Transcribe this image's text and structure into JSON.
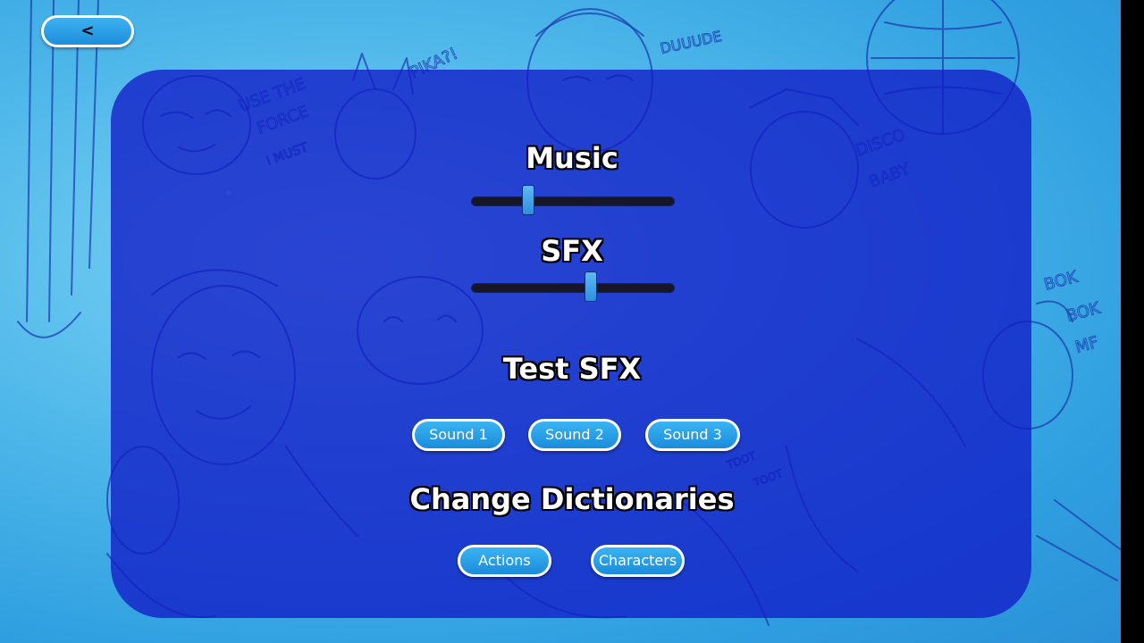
{
  "back_button": {
    "icon": "chevron-left-icon",
    "glyph": "<"
  },
  "settings": {
    "music": {
      "label": "Music",
      "value": 0.28
    },
    "sfx": {
      "label": "SFX",
      "value": 0.59
    },
    "test_sfx": {
      "label": "Test SFX",
      "buttons": [
        "Sound 1",
        "Sound 2",
        "Sound 3"
      ]
    },
    "dictionaries": {
      "label": "Change Dictionaries",
      "buttons": [
        "Actions",
        "Characters"
      ]
    }
  },
  "background_doodle_text": [
    "PIKA?!",
    "DUUUDE",
    "USE THE FORCE",
    "I MUST",
    "DISCO BABY",
    "BOK",
    "BOK",
    "MF",
    "TOOT",
    "TOOT"
  ],
  "colors": {
    "panel": "#121cc8",
    "button": "#1a8cdb",
    "background": "#4fb8ea"
  }
}
